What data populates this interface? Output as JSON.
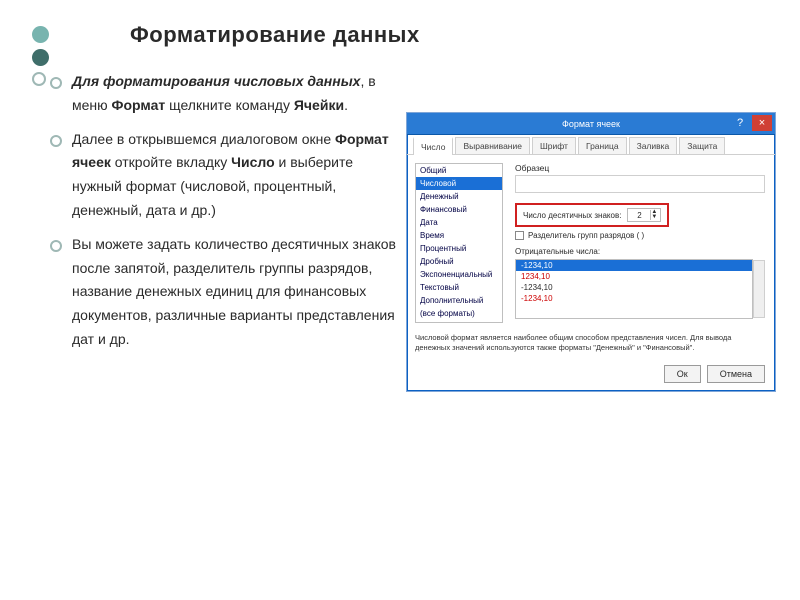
{
  "title": "Форматирование  данных",
  "bullets": {
    "b1_prefix_italic": "Для  форматирования  числовых  данных",
    "b1_mid1": ",  в  меню ",
    "b1_bold1": "Формат",
    "b1_mid2": "  щелкните команду ",
    "b1_bold2": "Ячейки",
    "b1_end": ".",
    "b2_a": "Далее  в  открывшемся  диалоговом окне ",
    "b2_bold1": "Формат  ячеек",
    "b2_b": "  откройте вкладку ",
    "b2_bold2": "Число",
    "b2_c": "  и  выберите  нужный формат  (числовой,  процентный, денежный,  дата  и  др.)",
    "b3": "Вы  можете  задать  количество десятичных  знаков  после  запятой, разделитель  группы  разрядов, название  денежных  единиц  для финансовых  документов,  различные варианты  представления  дат  и  др."
  },
  "dialog": {
    "title": "Формат ячеек",
    "help": "?",
    "close": "×",
    "tabs": [
      "Число",
      "Выравнивание",
      "Шрифт",
      "Граница",
      "Заливка",
      "Защита"
    ],
    "categories": [
      "Общий",
      "Числовой",
      "Денежный",
      "Финансовый",
      "Дата",
      "Время",
      "Процентный",
      "Дробный",
      "Экспоненциальный",
      "Текстовый",
      "Дополнительный",
      "(все форматы)"
    ],
    "sample_label": "Образец",
    "decimal_label": "Число десятичных знаков:",
    "decimal_value": "2",
    "sep_label": "Разделитель групп разрядов ( )",
    "neg_label": "Отрицательные числа:",
    "neg_items": [
      "-1234,10",
      "1234,10",
      "-1234,10",
      "-1234,10"
    ],
    "hint": "Числовой формат является наиболее общим способом представления чисел. Для вывода денежных значений используются также форматы \"Денежный\" и \"Финансовый\".",
    "ok": "Ок",
    "cancel": "Отмена"
  }
}
